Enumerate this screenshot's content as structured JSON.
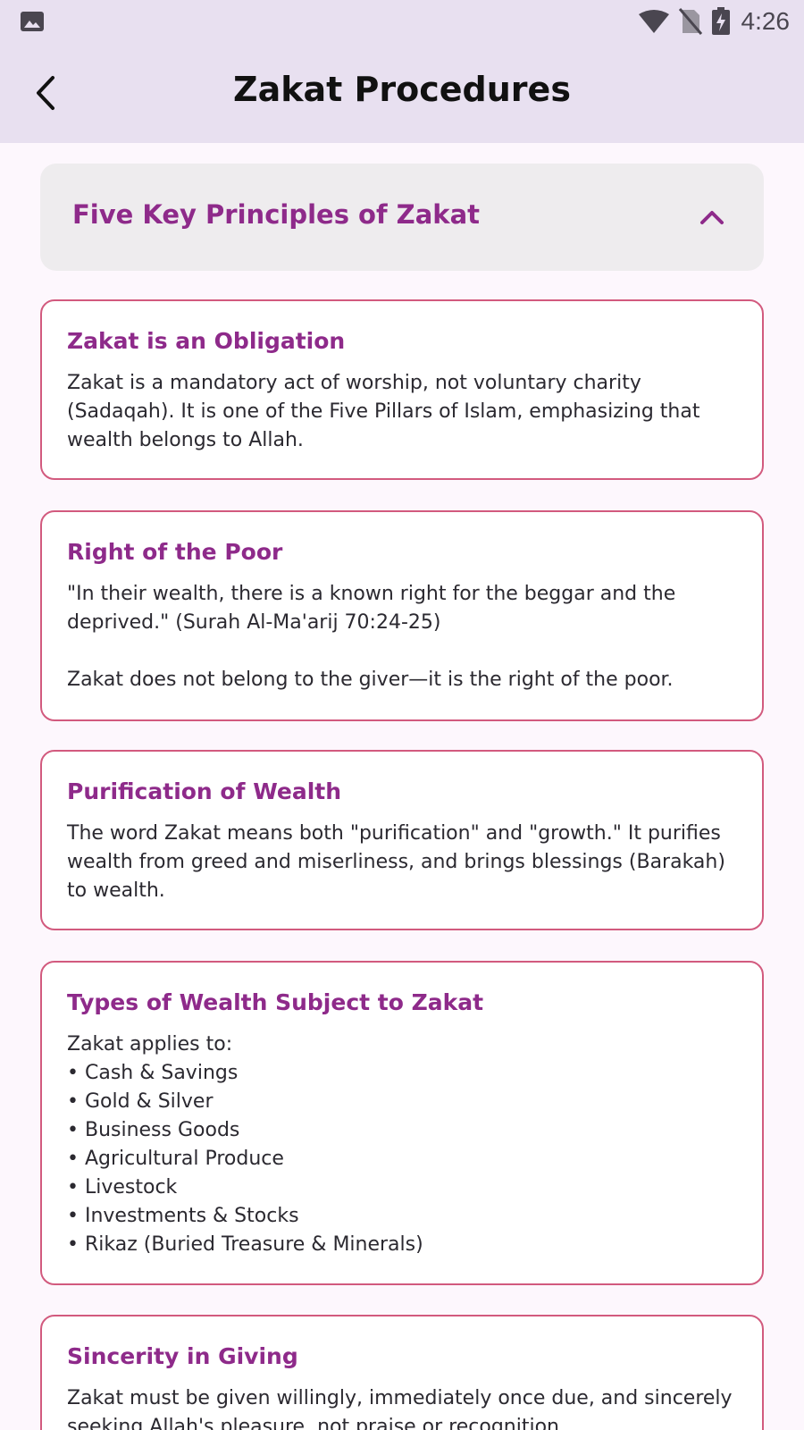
{
  "status_bar": {
    "time": "4:26",
    "icons": [
      "image-icon",
      "wifi-icon",
      "no-sim-icon",
      "battery-charging-icon"
    ]
  },
  "app_bar": {
    "title": "Zakat Procedures",
    "back_icon": "back-arrow-icon"
  },
  "accordion": {
    "title": "Five Key Principles of Zakat",
    "expanded": true,
    "icon": "chevron-up-icon"
  },
  "cards": [
    {
      "title": "Zakat is an Obligation",
      "body": "Zakat is a mandatory act of worship, not voluntary charity (Sadaqah). It is one of the Five Pillars of Islam, emphasizing that wealth belongs to Allah."
    },
    {
      "title": "Right of the Poor",
      "body": "\"In their wealth, there is a known right for the beggar and the deprived.\" (Surah Al-Ma'arij 70:24-25)\n\nZakat does not belong to the giver—it is the right of the poor."
    },
    {
      "title": "Purification of Wealth",
      "body": "The word Zakat means both \"purification\" and \"growth.\" It purifies wealth from greed and miserliness, and brings blessings (Barakah) to wealth."
    },
    {
      "title": "Types of Wealth Subject to Zakat",
      "body": "Zakat applies to:\n• Cash & Savings\n• Gold & Silver\n• Business Goods\n• Agricultural Produce\n• Livestock\n• Investments & Stocks\n• Rikaz (Buried Treasure & Minerals)"
    },
    {
      "title": "Sincerity in Giving",
      "body": "Zakat must be given willingly, immediately once due, and sincerely seeking Allah's pleasure, not praise or recognition."
    }
  ],
  "colors": {
    "accent": "#8e2a8a",
    "card_border": "#d25a7e",
    "app_bar_bg": "#e8e0f0",
    "page_bg": "#fdf7fd"
  }
}
